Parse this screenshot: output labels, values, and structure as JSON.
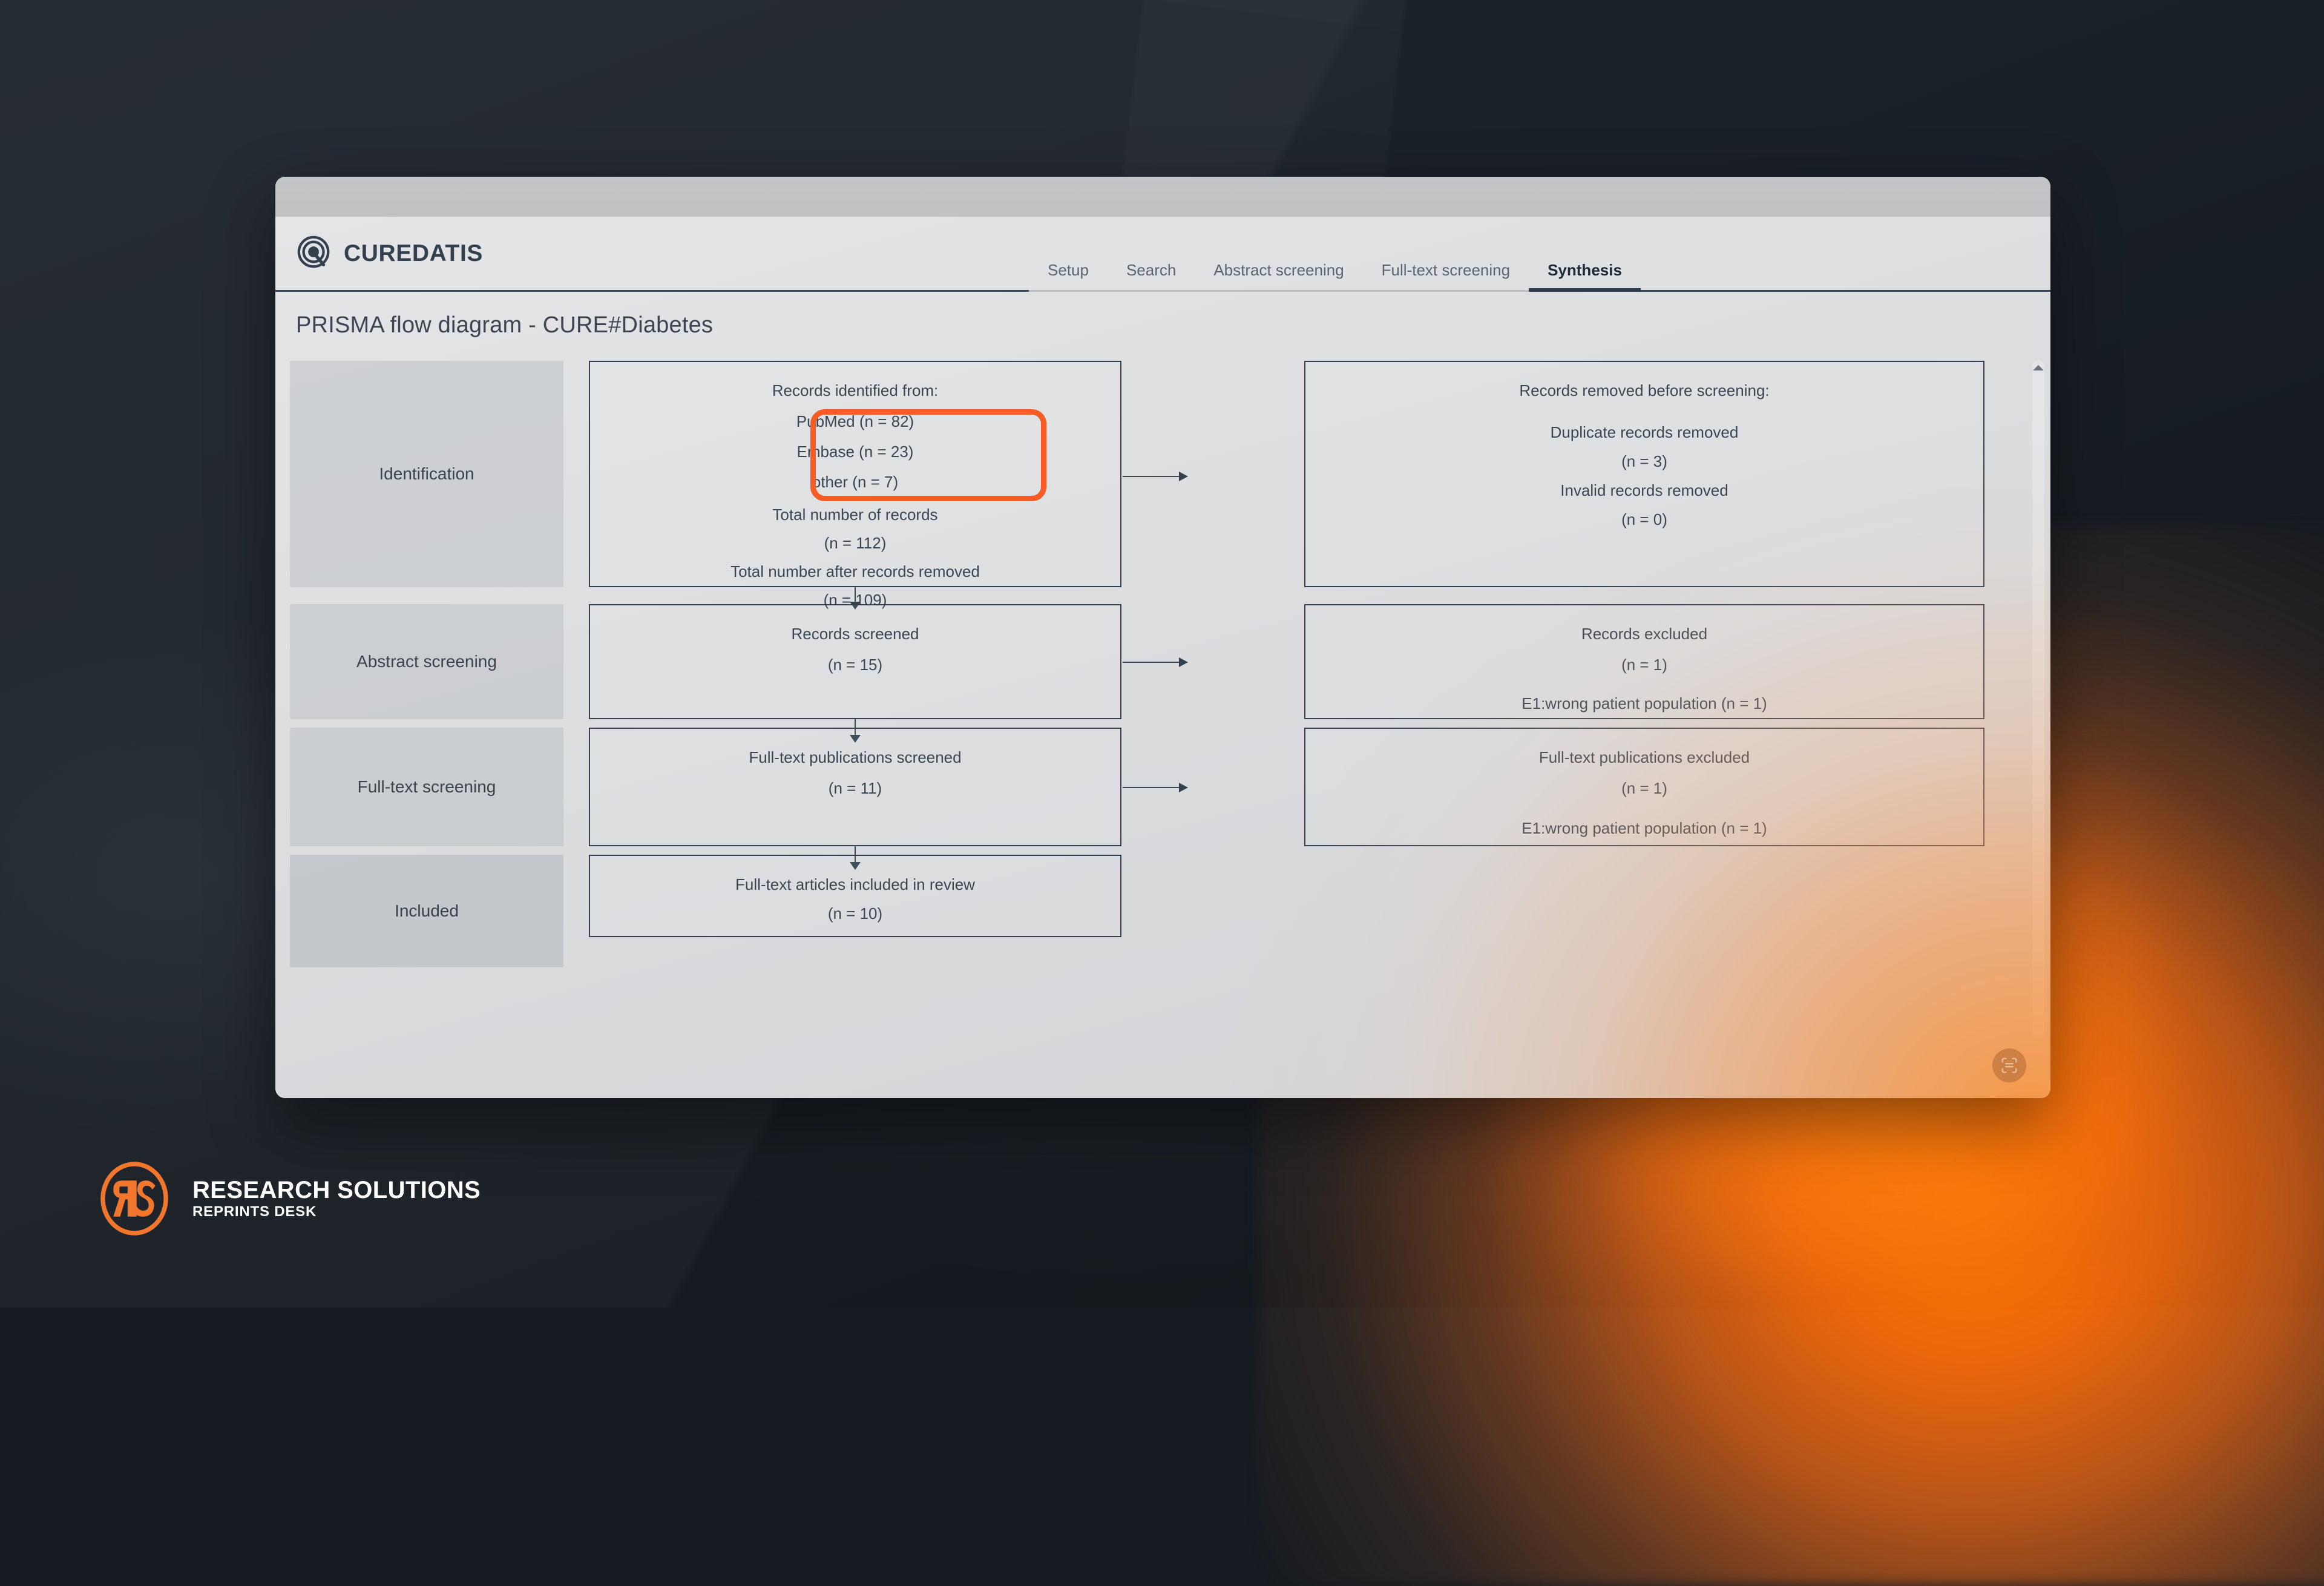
{
  "brand": {
    "name": "CUREDATIS",
    "mark_icon": "target-q-icon"
  },
  "nav": {
    "tabs": [
      {
        "label": "Setup",
        "active": false
      },
      {
        "label": "Search",
        "active": false
      },
      {
        "label": "Abstract screening",
        "active": false
      },
      {
        "label": "Full-text screening",
        "active": false
      },
      {
        "label": "Synthesis",
        "active": true
      }
    ]
  },
  "page": {
    "title": "PRISMA flow diagram - CURE#Diabetes"
  },
  "diagram": {
    "stages": [
      {
        "label": "Identification"
      },
      {
        "label": "Abstract screening"
      },
      {
        "label": "Full-text screening"
      },
      {
        "label": "Included"
      }
    ],
    "boxes": {
      "identification_left": {
        "heading": "Records identified from:",
        "highlighted": [
          "PubMed (n = 82)",
          "Embase (n = 23)",
          "other (n = 7)"
        ],
        "totals": [
          "Total number of records",
          "(n = 112)",
          "Total number after records removed",
          "(n = 109)"
        ]
      },
      "identification_right": {
        "heading": "Records removed before screening:",
        "lines": [
          "Duplicate records removed",
          "(n = 3)",
          "Invalid records removed",
          "(n = 0)"
        ]
      },
      "abstract_left": {
        "heading": "Records screened",
        "count": "(n = 15)"
      },
      "abstract_right": {
        "heading": "Records excluded",
        "count": "(n = 1)",
        "reason": "E1:wrong patient population (n = 1)"
      },
      "fulltext_left": {
        "heading": "Full-text publications screened",
        "count": "(n = 11)"
      },
      "fulltext_right": {
        "heading": "Full-text publications excluded",
        "count": "(n = 1)",
        "reason": "E1:wrong patient population (n = 1)"
      },
      "included": {
        "heading": "Full-text articles included in review",
        "count": "(n = 10)"
      }
    },
    "highlight_color": "#f95b24"
  },
  "fab": {
    "icon": "scan-frame-icon"
  },
  "scrollbar": {
    "up_arrow_icon": "chevron-up-icon"
  },
  "watermark": {
    "mark_icon": "rs-circle-icon",
    "title": "RESEARCH SOLUTIONS",
    "subtitle": "REPRINTS DESK",
    "accent_color": "#f2762b"
  }
}
